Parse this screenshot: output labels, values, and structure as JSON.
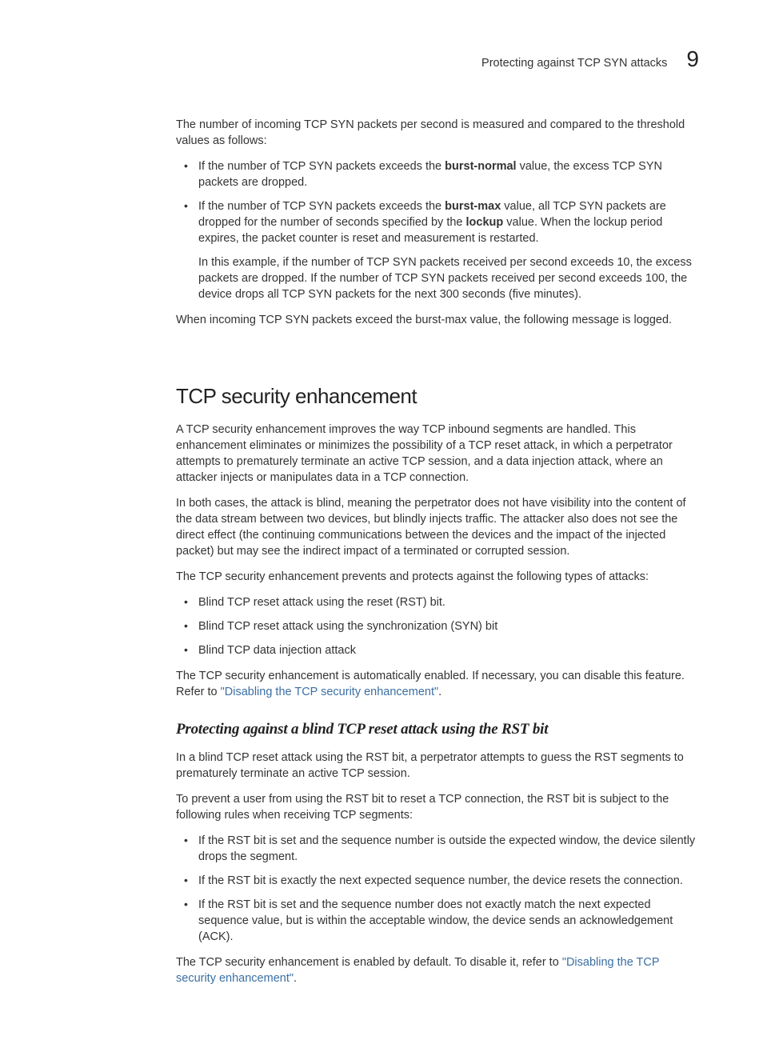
{
  "header": {
    "title": "Protecting against TCP SYN attacks",
    "chapter_number": "9"
  },
  "intro": {
    "p1": "The number of incoming TCP SYN packets per second is measured and compared to the threshold values as follows:",
    "b1_pre": "If the number of TCP SYN packets exceeds the ",
    "b1_bold": "burst-normal",
    "b1_post": " value, the excess TCP SYN packets are dropped.",
    "b2_seg1": "If the number of TCP SYN packets exceeds the ",
    "b2_bold1": "burst-max",
    "b2_seg2": " value, all TCP SYN packets are dropped for the number of seconds specified by the ",
    "b2_bold2": "lockup",
    "b2_seg3": " value. When the lockup period expires, the packet counter is reset and measurement is restarted.",
    "b2_sub": "In this example, if the number of TCP SYN packets received per second exceeds 10, the excess packets are dropped. If the number of TCP SYN packets received per second exceeds 100, the device drops all TCP SYN packets for the next 300 seconds (five minutes).",
    "p2": "When incoming TCP SYN packets exceed the burst-max value, the following message is logged."
  },
  "sec1": {
    "heading": "TCP security enhancement",
    "p1": "A TCP security enhancement improves the way TCP inbound segments are handled. This enhancement eliminates or minimizes the possibility of a TCP reset attack, in which a perpetrator attempts to prematurely terminate an active TCP session, and a data injection attack, where an attacker injects or manipulates data in a TCP connection.",
    "p2": "In both cases, the attack is blind, meaning the perpetrator does not have visibility into the content of the data stream between two devices, but blindly injects traffic. The attacker also does not see the direct effect (the continuing communications between the devices and the impact of the injected packet) but may see the indirect impact of a terminated or corrupted session.",
    "p3": "The TCP security enhancement prevents and protects against the following types of attacks:",
    "b1": "Blind TCP reset attack using the reset (RST) bit.",
    "b2": "Blind TCP reset attack using the synchronization (SYN) bit",
    "b3": "Blind TCP data injection attack",
    "p4_pre": "The TCP security enhancement is automatically enabled. If necessary, you can disable this feature. Refer to ",
    "p4_link": "\"Disabling the TCP security enhancement\"",
    "p4_post": "."
  },
  "sec2": {
    "heading": "Protecting against a blind TCP reset attack using the RST bit",
    "p1": "In a blind TCP reset attack using the RST bit, a perpetrator attempts to guess the RST segments to prematurely terminate an active TCP session.",
    "p2": "To prevent a user from using the RST bit to reset a TCP connection, the RST bit is subject to the following rules when receiving TCP segments:",
    "b1": "If the RST bit is set and the sequence number is outside the expected window, the device silently drops the segment.",
    "b2": "If the RST bit is exactly the next expected sequence number, the device resets the connection.",
    "b3": "If the RST bit is set and the sequence number does not exactly match the next expected sequence value, but is within the acceptable window, the device sends an acknowledgement (ACK).",
    "p3_pre": "The TCP security enhancement is enabled by default. To disable it, refer to ",
    "p3_link": "\"Disabling the TCP security enhancement\"",
    "p3_post": "."
  }
}
